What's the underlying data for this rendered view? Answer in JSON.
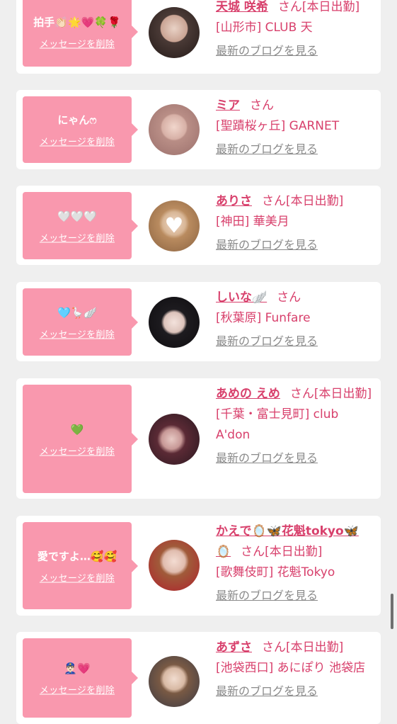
{
  "delete_label": "メッセージを削除",
  "blog_label": "最新のブログを見る",
  "entries": [
    {
      "message": "拍手👏🏻🌟💗🍀🌹",
      "name": "天城 咲希",
      "suffix": "さん[本日出勤]",
      "shop": "[山形市] CLUB 天"
    },
    {
      "message": "にゃんෆ",
      "name": "ミア",
      "suffix": "さん",
      "shop": "[聖蹟桜ヶ丘] GARNET"
    },
    {
      "message": "🤍🤍🤍",
      "name": "ありさ",
      "suffix": "さん[本日出勤]",
      "shop": "[神田] 華美月"
    },
    {
      "message": "🩵🪿🪽",
      "name": "しいな🪽",
      "suffix": "さん",
      "shop": "[秋葉原] Funfare"
    },
    {
      "message": "💚",
      "name": "あめの えめ",
      "suffix": "さん[本日出勤]",
      "shop": "[千葉・富士見町] club A'don"
    },
    {
      "message": "愛ですよ…🥰🥰",
      "name": "かえで🪞🦋花魁tokyo🦋🪞",
      "suffix": "さん[本日出勤]",
      "shop": "[歌舞伎町] 花魁Tokyo"
    },
    {
      "message": "👮🏻‍♂️💗",
      "name": "あずさ",
      "suffix": "さん[本日出勤]",
      "shop": "[池袋西口] あにぽり 池袋店"
    }
  ],
  "colors": {
    "background": "#efefef",
    "bubble": "#f998ae",
    "accent": "#d8406c",
    "link_gray": "#8a8a8a"
  }
}
